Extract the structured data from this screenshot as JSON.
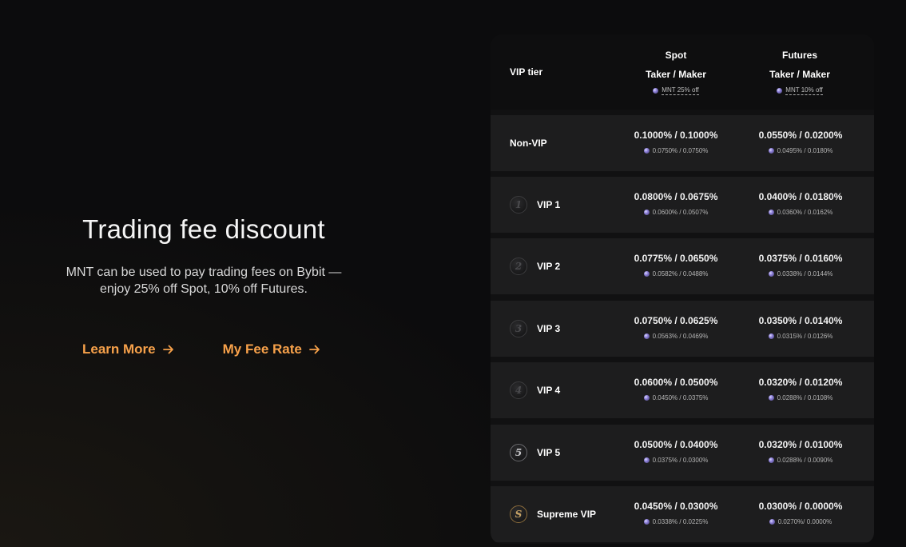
{
  "promo": {
    "title": "Trading fee discount",
    "description_line1": "MNT can be used to pay trading fees on Bybit —",
    "description_line2": "enjoy 25% off Spot, 10% off Futures.",
    "learn_more": "Learn More",
    "my_fee_rate": "My Fee Rate",
    "accent_color": "#f7a14a"
  },
  "table": {
    "tier_header": "VIP tier",
    "spot_header": "Spot",
    "futures_header": "Futures",
    "taker_maker": "Taker / Maker",
    "spot_discount": "MNT 25% off",
    "futures_discount": "MNT 10% off",
    "rows": [
      {
        "tier": "Non-VIP",
        "badge": "",
        "spot": "0.1000% / 0.1000%",
        "spot_mnt": "0.0750% / 0.0750%",
        "futures": "0.0550% / 0.0200%",
        "futures_mnt": "0.0495% / 0.0180%"
      },
      {
        "tier": "VIP 1",
        "badge": "1",
        "spot": "0.0800% / 0.0675%",
        "spot_mnt": "0.0600% / 0.0507%",
        "futures": "0.0400% / 0.0180%",
        "futures_mnt": "0.0360% / 0.0162%"
      },
      {
        "tier": "VIP 2",
        "badge": "2",
        "spot": "0.0775% / 0.0650%",
        "spot_mnt": "0.0582% / 0.0488%",
        "futures": "0.0375% / 0.0160%",
        "futures_mnt": "0.0338% / 0.0144%"
      },
      {
        "tier": "VIP 3",
        "badge": "3",
        "spot": "0.0750% / 0.0625%",
        "spot_mnt": "0.0563% / 0.0469%",
        "futures": "0.0350% / 0.0140%",
        "futures_mnt": "0.0315% / 0.0126%"
      },
      {
        "tier": "VIP 4",
        "badge": "4",
        "spot": "0.0600% / 0.0500%",
        "spot_mnt": "0.0450% / 0.0375%",
        "futures": "0.0320% / 0.0120%",
        "futures_mnt": "0.0288% / 0.0108%"
      },
      {
        "tier": "VIP 5",
        "badge": "5",
        "spot": "0.0500% / 0.0400%",
        "spot_mnt": "0.0375% / 0.0300%",
        "futures": "0.0320% / 0.0100%",
        "futures_mnt": "0.0288% / 0.0090%"
      },
      {
        "tier": "Supreme VIP",
        "badge": "S",
        "spot": "0.0450% / 0.0300%",
        "spot_mnt": "0.0338% / 0.0225%",
        "futures": "0.0300% / 0.0000%",
        "futures_mnt": "0.0270%/ 0.0000%"
      }
    ]
  }
}
